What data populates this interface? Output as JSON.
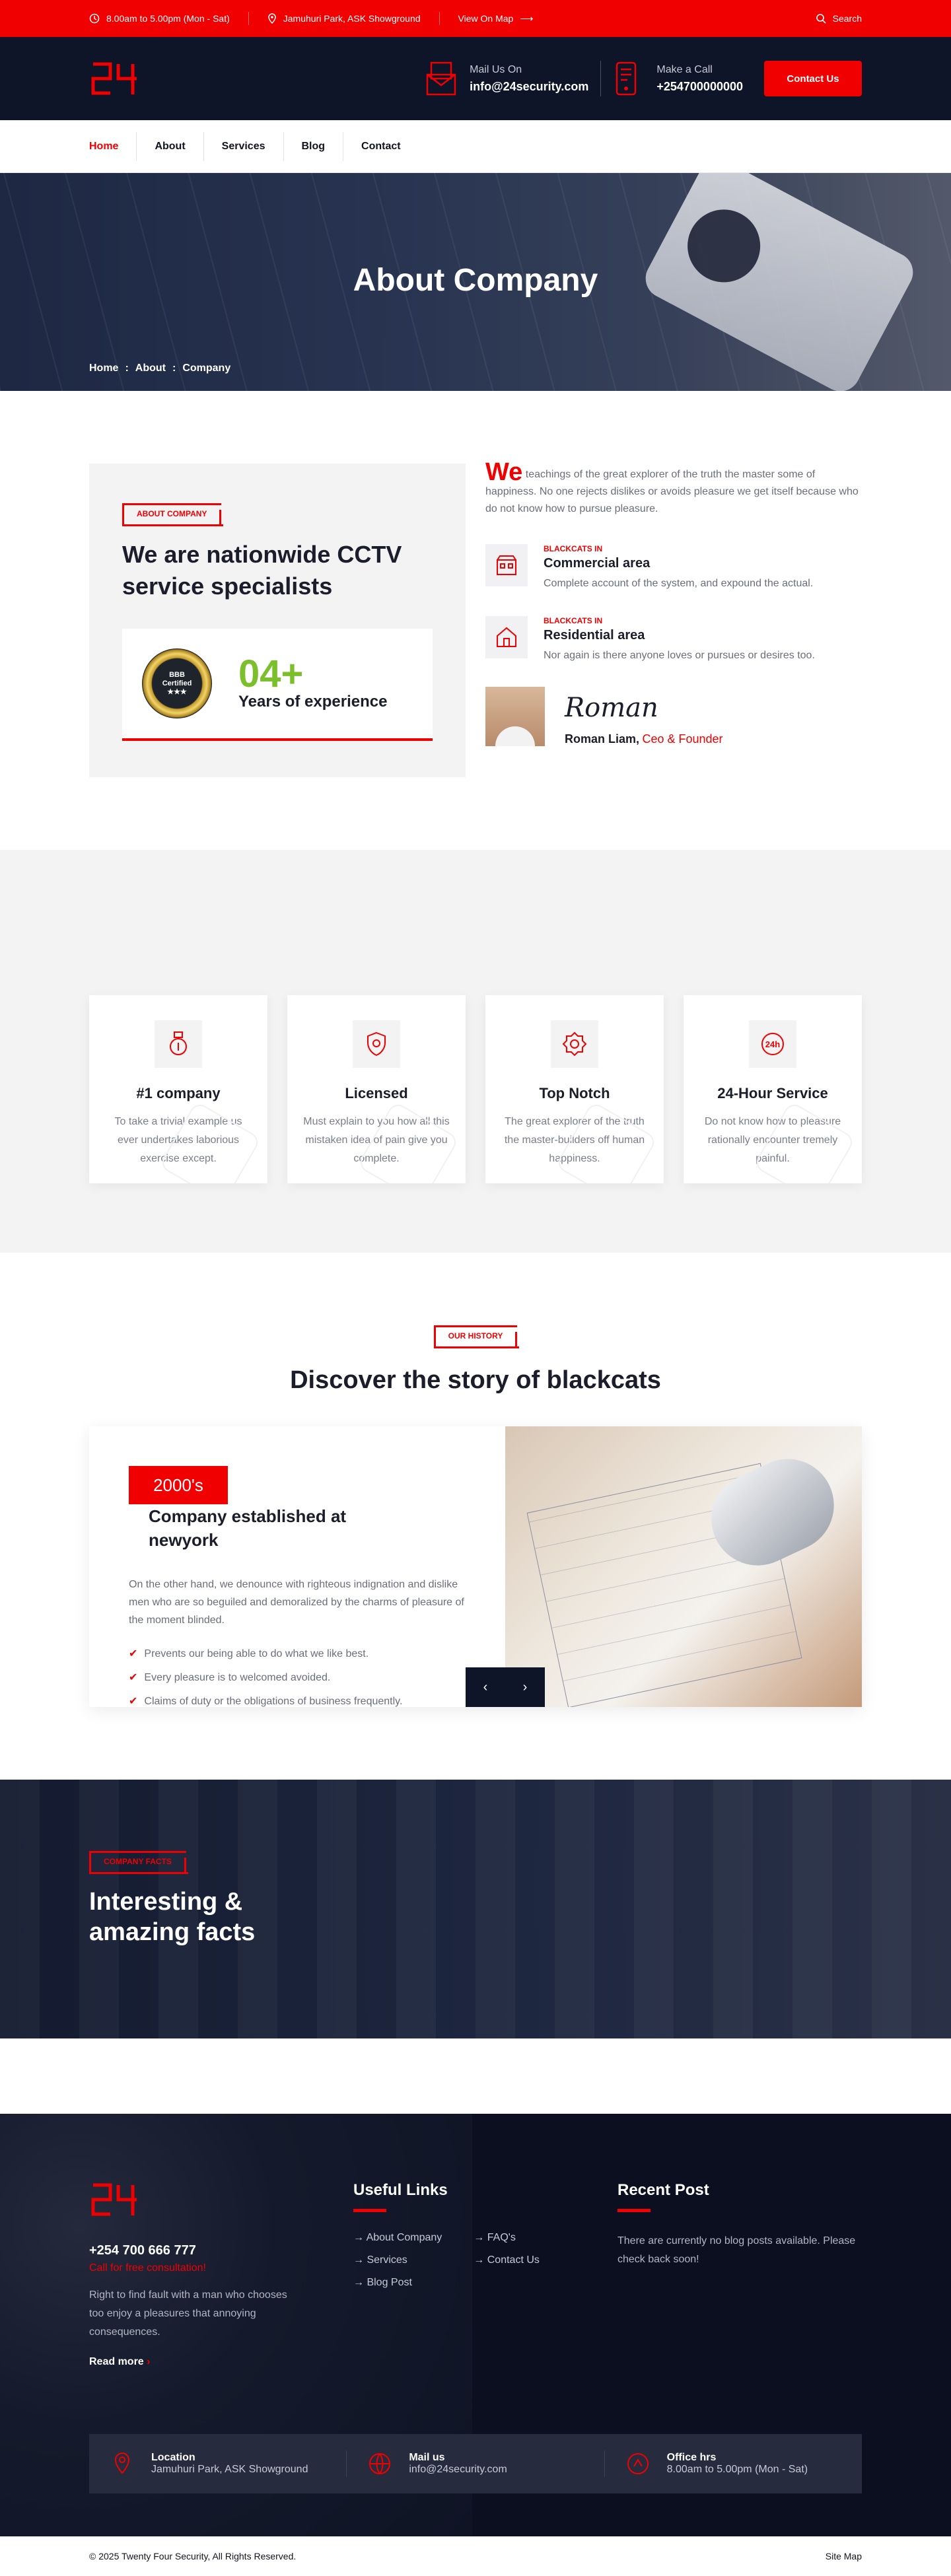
{
  "topbar": {
    "hours": "8.00am to 5.00pm (Mon - Sat)",
    "location": "Jamuhuri Park, ASK Showground",
    "map_link": "View On Map",
    "search": "Search"
  },
  "header": {
    "logo": "24",
    "mail_label": "Mail Us On",
    "mail_value": "info@24security.com",
    "call_label": "Make a Call",
    "call_value": "+254700000000",
    "cta": "Contact Us"
  },
  "nav": [
    "Home",
    "About",
    "Services",
    "Blog",
    "Contact"
  ],
  "hero": {
    "title": "About Company",
    "breadcrumb": [
      "Home",
      ":",
      "About",
      ":",
      "Company"
    ]
  },
  "about": {
    "tag": "ABOUT COMPANY",
    "heading": "We are nationwide CCTV service specialists",
    "badge_line1": "BBB",
    "badge_line2": "Certified",
    "badge_stars": "★★★",
    "years": "04+",
    "years_label": "Years of experience",
    "lead_drop": "We",
    "lead": "teachings of the great explorer of the truth the master some of happiness. No one rejects dislikes or avoids pleasure we get itself because who do not know how to pursue pleasure.",
    "features": [
      {
        "small": "BLACKCATS IN",
        "title": "Commercial area",
        "text": "Complete account of the system, and expound the actual."
      },
      {
        "small": "BLACKCATS IN",
        "title": "Residential area",
        "text": "Nor again is there anyone loves or pursues or desires too."
      }
    ],
    "signature": "Roman",
    "author_name": "Roman Liam,",
    "author_role": "Ceo & Founder"
  },
  "services": [
    {
      "title": "#1 company",
      "text": "To take a trivial example us ever undertakes laborious exercise except."
    },
    {
      "title": "Licensed",
      "text": "Must explain to you how all this mistaken idea of pain give you complete."
    },
    {
      "title": "Top Notch",
      "text": "The great explorer of the truth the master-builders off human happiness."
    },
    {
      "title": "24-Hour Service",
      "text": "Do not know how to pleasure rationally encounter tremely painful."
    }
  ],
  "history": {
    "tag": "OUR HISTORY",
    "heading": "Discover the story of blackcats",
    "year": "2000's",
    "title": "Company established at newyork",
    "text": "On the other hand, we denounce with righteous indignation and dislike men who are so beguiled and demoralized by the charms of pleasure of the moment blinded.",
    "points": [
      "Prevents our being able to do what we like best.",
      "Every pleasure is to welcomed avoided.",
      "Claims of duty or the obligations of business frequently."
    ],
    "prev": "‹",
    "next": "›"
  },
  "facts": {
    "tag": "COMPANY FACTS",
    "line1": "Interesting &",
    "line2": "amazing facts"
  },
  "footer": {
    "logo": "24",
    "phone": "+254 700 666 777",
    "cta": "Call for free consultation!",
    "desc": "Right to find fault with a man who chooses too enjoy a pleasures that annoying consequences.",
    "more": "Read more",
    "links_title": "Useful Links",
    "links_col1": [
      "About Company",
      "Services",
      "Blog Post"
    ],
    "links_col2": [
      "FAQ's",
      "Contact Us"
    ],
    "posts_title": "Recent Post",
    "posts_text": "There are currently no blog posts available. Please check back soon!",
    "bar": [
      {
        "label": "Location",
        "value": "Jamuhuri Park, ASK Showground"
      },
      {
        "label": "Mail us",
        "value": "info@24security.com"
      },
      {
        "label": "Office hrs",
        "value": "8.00am to 5.00pm (Mon - Sat)"
      }
    ],
    "copyright": "© 2025 Twenty Four Security, All Rights Reserved.",
    "sitemap": "Site Map"
  },
  "colors": {
    "accent": "#f00000",
    "dark": "#0f1528",
    "green": "#7bbf2b"
  }
}
